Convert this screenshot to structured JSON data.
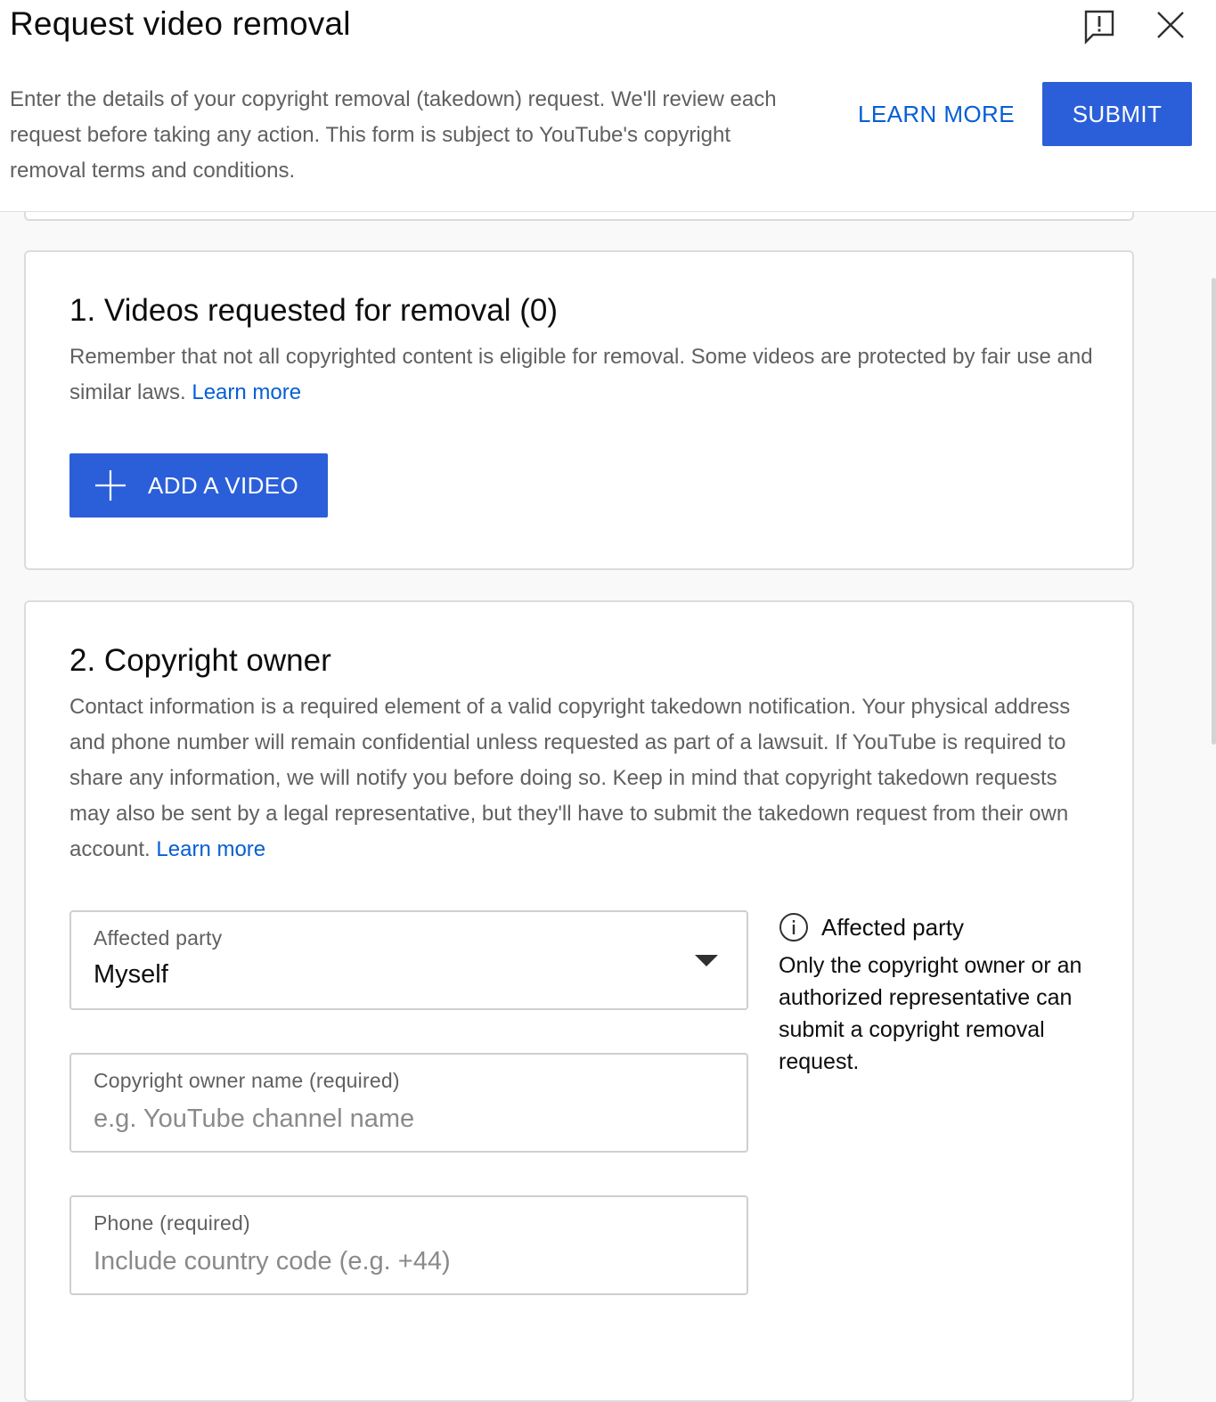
{
  "header": {
    "title": "Request video removal",
    "intro": "Enter the details of your copyright removal (takedown) request. We'll review each request before taking any action. This form is subject to YouTube's copyright removal terms and conditions.",
    "learn_more_label": "LEARN MORE",
    "submit_label": "SUBMIT",
    "feedback_icon": "feedback-icon",
    "close_icon": "close-icon"
  },
  "section1": {
    "title": "1. Videos requested for removal (0)",
    "description": "Remember that not all copyrighted content is eligible for removal. Some videos are protected by fair use and similar laws.",
    "learn_more": "Learn more",
    "add_video_label": "ADD A VIDEO",
    "add_icon": "plus-icon"
  },
  "section2": {
    "title": "2. Copyright owner",
    "description": "Contact information is a required element of a valid copyright takedown notification. Your physical address and phone number will remain confidential unless requested as part of a lawsuit. If YouTube is required to share any information, we will notify you before doing so. Keep in mind that copyright takedown requests may also be sent by a legal representative, but they'll have to submit the takedown request from their own account.",
    "learn_more": "Learn more",
    "affected_party": {
      "label": "Affected party",
      "value": "Myself"
    },
    "owner_name": {
      "label": "Copyright owner name (required)",
      "placeholder": "e.g. YouTube channel name"
    },
    "phone": {
      "label": "Phone (required)",
      "placeholder": "Include country code (e.g. +44)"
    },
    "info": {
      "icon": "info-icon",
      "title": "Affected party",
      "body": "Only the copyright owner or an authorized representative can submit a copyright removal request."
    }
  },
  "colors": {
    "accent": "#2b5fd9",
    "link": "#065fd4",
    "border": "#dcdcdc",
    "secondary_text": "#606060"
  }
}
